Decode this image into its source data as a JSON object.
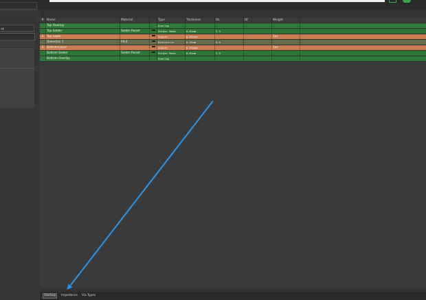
{
  "left_panel": {
    "field_text": "up"
  },
  "stack_header": {
    "idx": "#",
    "name": "Name",
    "material": "Material",
    "type": "Type",
    "thickness": "Thickness",
    "dk": "Dk",
    "df": "Df",
    "weight": "Weight"
  },
  "rows": [
    {
      "idx": "",
      "name": "Top Overlay",
      "material": "",
      "ext": false,
      "type": "Overlay",
      "thickness": "",
      "dk": "",
      "df": "",
      "weight": "",
      "color": "#2f7a3a"
    },
    {
      "idx": "",
      "name": "Top Solder",
      "material": "Solder Resist",
      "ext": true,
      "type": "Solder Mask",
      "thickness": "0.01mm",
      "dk": "3.5",
      "df": "",
      "weight": "",
      "color": "#2d7638"
    },
    {
      "idx": "1",
      "name": "Top Layer",
      "material": "",
      "ext": true,
      "type": "Signal",
      "thickness": "0.036mm",
      "dk": "",
      "df": "",
      "weight": "1oz",
      "color": "#c97c52"
    },
    {
      "idx": "",
      "name": "Dielectric 1",
      "material": "FR-4",
      "ext": true,
      "type": "Dielectric",
      "thickness": "0.32mm",
      "dk": "4.5",
      "df": "",
      "weight": "",
      "color": "#676a4c"
    },
    {
      "idx": "2",
      "name": "Bottom Layer",
      "material": "",
      "ext": true,
      "type": "Signal",
      "thickness": "0.036mm",
      "dk": "",
      "df": "",
      "weight": "1oz",
      "color": "#c97c52"
    },
    {
      "idx": "",
      "name": "Bottom Solder",
      "material": "Solder Resist",
      "ext": true,
      "type": "Solder Mask",
      "thickness": "0.01mm",
      "dk": "3.5",
      "df": "",
      "weight": "",
      "color": "#2d7638"
    },
    {
      "idx": "",
      "name": "Bottom Overlay",
      "material": "",
      "ext": false,
      "type": "Overlay",
      "thickness": "",
      "dk": "",
      "df": "",
      "weight": "",
      "color": "#2f7a3a"
    }
  ],
  "tabs": [
    {
      "label": "Stackup",
      "active": true
    },
    {
      "label": "Impedance",
      "active": false
    },
    {
      "label": "Via Types",
      "active": false
    }
  ],
  "colors": {
    "annotation_arrow": "#2a8fe0",
    "accent_green": "#3fa34d"
  }
}
